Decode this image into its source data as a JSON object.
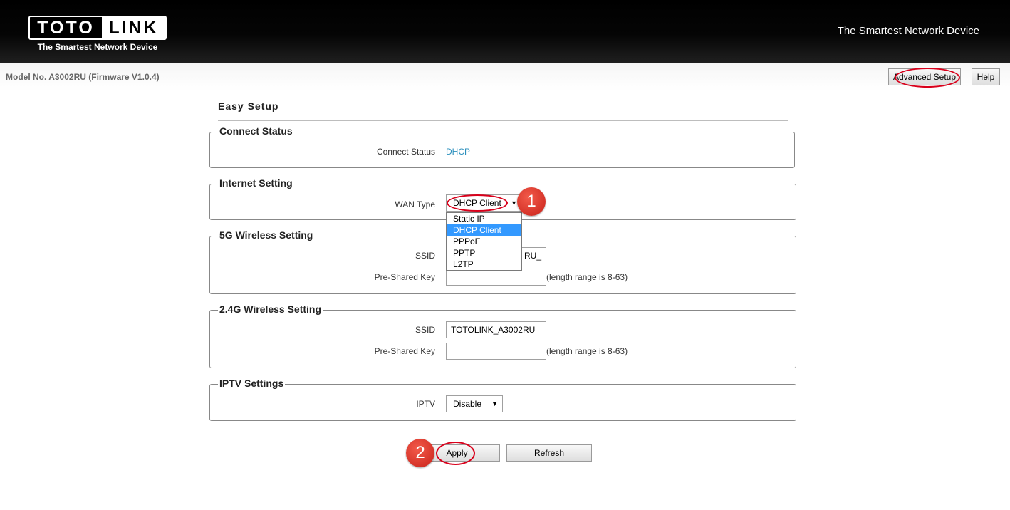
{
  "header": {
    "logo_left": "TOTO",
    "logo_right": "LINK",
    "logo_tagline": "The Smartest Network Device",
    "tagline": "The Smartest Network Device"
  },
  "model_bar": {
    "model_text": "Model No. A3002RU (Firmware V1.0.4)",
    "advanced_setup": "Advanced Setup",
    "help": "Help"
  },
  "page_title": "Easy Setup",
  "connect_status": {
    "legend": "Connect Status",
    "label": "Connect Status",
    "value": "DHCP",
    "value_color": "#2a8fbd"
  },
  "internet_setting": {
    "legend": "Internet Setting",
    "wan_label": "WAN Type",
    "wan_selected": "DHCP Client",
    "wan_options": [
      "Static IP",
      "DHCP Client",
      "PPPoE",
      "PPTP",
      "L2TP"
    ],
    "badge": "1"
  },
  "wireless_5g": {
    "legend": "5G Wireless Setting",
    "ssid_label": "SSID",
    "ssid_value_visible": "RU_",
    "psk_label": "Pre-Shared Key",
    "psk_value": "",
    "psk_hint": "(length range is 8-63)"
  },
  "wireless_24g": {
    "legend": "2.4G Wireless Setting",
    "ssid_label": "SSID",
    "ssid_value": "TOTOLINK_A3002RU",
    "psk_label": "Pre-Shared Key",
    "psk_value": "",
    "psk_hint": "(length range is 8-63)"
  },
  "iptv": {
    "legend": "IPTV Settings",
    "label": "IPTV",
    "selected": "Disable"
  },
  "actions": {
    "apply": "Apply",
    "refresh": "Refresh",
    "badge": "2"
  },
  "colors": {
    "highlight_oval": "#d9001b",
    "badge": "#d8352a",
    "selected_option": "#3399ff"
  }
}
